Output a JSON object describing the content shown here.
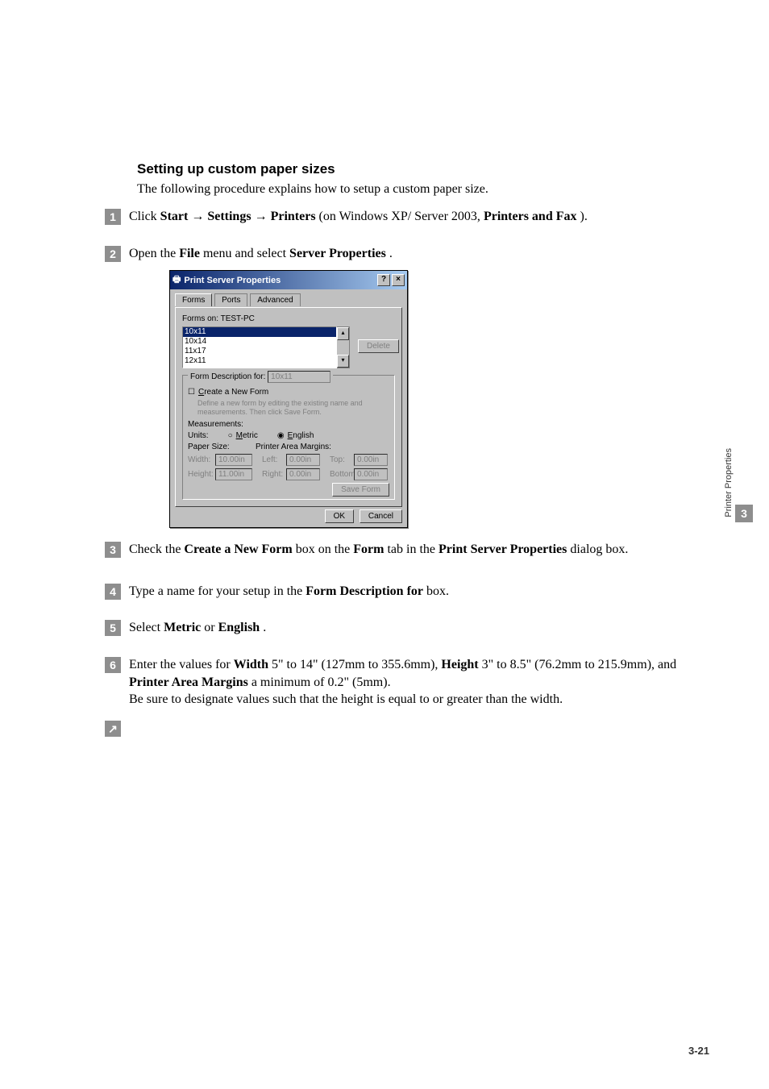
{
  "heading": "Setting up custom paper sizes",
  "intro": "The following procedure explains how to setup a custom paper size.",
  "steps": {
    "s1_a": "Click ",
    "s1_b1": "Start",
    "s1_b2": "Settings",
    "s1_b3": "Printers",
    "s1_c": " (on Windows XP/ Server 2003, ",
    "s1_d": "Printers and Fax",
    "s1_e": ").",
    "s2_a": "Open the ",
    "s2_b": "File",
    "s2_c": " menu and select ",
    "s2_d": "Server Properties",
    "s2_e": ".",
    "s3_a": "Check the ",
    "s3_b": "Create a New Form",
    "s3_c": " box on the ",
    "s3_d": "Form",
    "s3_e": " tab in the ",
    "s3_f": "Print Server Properties",
    "s3_g": " dialog box.",
    "s4_a": "Type a name for your setup in the ",
    "s4_b": "Form Description for",
    "s4_c": " box.",
    "s5_a": "Select ",
    "s5_b": "Metric",
    "s5_c": " or ",
    "s5_d": "English",
    "s5_e": ".",
    "s6_a": "Enter the values for ",
    "s6_b": "Width",
    "s6_c": " 5\" to 14\" (127mm to 355.6mm), ",
    "s6_d": "Height",
    "s6_e": " 3\" to 8.5\" (76.2mm to 215.9mm), and ",
    "s6_f": "Printer Area Margins",
    "s6_g": " a minimum of 0.2\" (5mm).",
    "s6_h": "Be sure to designate values such that the height is equal to or greater than the width."
  },
  "dialog": {
    "title": "Print Server Properties",
    "help": "?",
    "close": "×",
    "tabs": {
      "forms": "Forms",
      "ports": "Ports",
      "advanced": "Advanced"
    },
    "forms_on": "Forms on: TEST-PC",
    "list": {
      "i0": "10x11",
      "i1": "10x14",
      "i2": "11x17",
      "i3": "12x11"
    },
    "delete": "Delete",
    "form_desc_label": "Form Description for:",
    "form_desc_value": "10x11",
    "create_new": "Create a New Form",
    "create_u": "C",
    "hint": "Define a new form by editing the existing name and measurements. Then click Save Form.",
    "measurements": "Measurements:",
    "units": "Units:",
    "metric": "Metric",
    "metric_u": "M",
    "english": "English",
    "english_u": "E",
    "paper_size": "Paper Size:",
    "printer_margins": "Printer Area Margins:",
    "width_l": "Width:",
    "width_v": "10.00in",
    "height_l": "Height:",
    "height_v": "11.00in",
    "left_l": "Left:",
    "left_v": "0.00in",
    "right_l": "Right:",
    "right_v": "0.00in",
    "top_l": "Top:",
    "top_v": "0.00in",
    "bottom_l": "Bottom:",
    "bottom_v": "0.00in",
    "save_form": "Save Form",
    "ok": "OK",
    "cancel": "Cancel"
  },
  "side": {
    "num": "3",
    "label": "Printer Properties"
  },
  "footer": "3-21",
  "arrow": "→",
  "last_step": "↗"
}
